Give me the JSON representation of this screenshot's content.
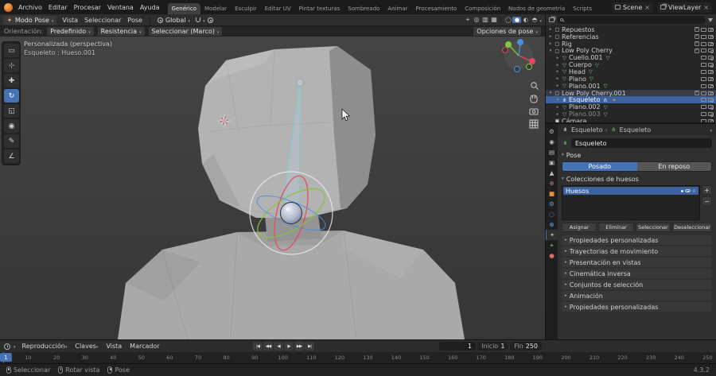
{
  "colors": {
    "accent": "#4772b3",
    "selection": "#3c62a0",
    "axis_x": "#e5485a",
    "axis_y": "#84c43c",
    "axis_z": "#4a8fe0",
    "bone_selected_outline": "#7bcfd2"
  },
  "topbar": {
    "menus": [
      "Archivo",
      "Editar",
      "Procesar",
      "Ventana",
      "Ayuda"
    ],
    "workspaces": [
      "Genérico",
      "Modelar",
      "Esculpir",
      "Editar UV",
      "Pintar texturas",
      "Sombreado",
      "Animar",
      "Procesamiento",
      "Composición",
      "Nodos de geometría",
      "Scripts"
    ],
    "active_workspace": "Genérico",
    "scene_label": "Scene",
    "view_layer_label": "ViewLayer"
  },
  "viewport_header": {
    "mode_label": "Modo Pose",
    "mode_icon": "pose-mode-icon",
    "mode_glyph": "✦",
    "menus": [
      "Vista",
      "Seleccionar",
      "Pose"
    ],
    "orientation": "Global",
    "overlay_toggles": [
      {
        "name": "selectability",
        "glyph": "⌖"
      },
      {
        "name": "gizmos",
        "glyph": "◎"
      },
      {
        "name": "overlays",
        "glyph": "▥"
      },
      {
        "name": "xray",
        "glyph": "▦"
      }
    ],
    "shading_modes": [
      {
        "name": "wireframe",
        "glyph": "◯"
      },
      {
        "name": "solid",
        "glyph": "●",
        "active": true
      },
      {
        "name": "material",
        "glyph": "◐"
      },
      {
        "name": "rendered",
        "glyph": "◓"
      }
    ]
  },
  "tool_settings": {
    "orientation_label": "Orientación:",
    "orientation_value": "Predefinido",
    "falloff_label": "Resistencia",
    "select_box_label": "Seleccionar (Marco)",
    "pose_options_label": "Opciones de pose"
  },
  "toolbar": {
    "tools": [
      {
        "name": "select-box",
        "glyph": "▭"
      },
      {
        "name": "cursor",
        "glyph": "⊹"
      },
      {
        "name": "move",
        "glyph": "✚"
      },
      {
        "name": "rotate",
        "glyph": "↻",
        "active": true
      },
      {
        "name": "scale",
        "glyph": "◱"
      },
      {
        "name": "transform",
        "glyph": "◉"
      },
      {
        "name": "annotate",
        "glyph": "✎"
      },
      {
        "name": "measure",
        "glyph": "∠"
      }
    ]
  },
  "viewport": {
    "view_label": "Personalizada (perspectiva)",
    "active_label": "Esqueleto : Hueso.001"
  },
  "outliner": {
    "type_icons": {
      "collection": "▢",
      "mesh": "▽",
      "armature": "⋔",
      "camera": "▣"
    },
    "rows": [
      {
        "label": "Repuestos",
        "depth": 0,
        "type": "collection",
        "arrow": "closed"
      },
      {
        "label": "Referencias",
        "depth": 0,
        "type": "collection",
        "arrow": "closed"
      },
      {
        "label": "Rig",
        "depth": 0,
        "type": "collection",
        "arrow": "closed"
      },
      {
        "label": "Low Poly Cherry",
        "depth": 0,
        "type": "collection",
        "arrow": "open"
      },
      {
        "label": "Cuello.001",
        "depth": 1,
        "type": "mesh",
        "arrow": "closed"
      },
      {
        "label": "Cuerpo",
        "depth": 1,
        "type": "mesh",
        "arrow": "closed"
      },
      {
        "label": "Head",
        "depth": 1,
        "type": "mesh",
        "arrow": "closed"
      },
      {
        "label": "Plano",
        "depth": 1,
        "type": "mesh",
        "arrow": "closed"
      },
      {
        "label": "Plano.001",
        "depth": 1,
        "type": "mesh",
        "arrow": "closed"
      },
      {
        "label": "Low Poly Cherry.001",
        "depth": 0,
        "type": "collection",
        "arrow": "open",
        "active": true
      },
      {
        "label": "Esqueleto",
        "depth": 1,
        "type": "armature",
        "arrow": "open",
        "selected": true
      },
      {
        "label": "Plano.002",
        "depth": 1,
        "type": "mesh",
        "arrow": "closed"
      },
      {
        "label": "Plano.003",
        "depth": 1,
        "type": "mesh",
        "arrow": "closed",
        "dim": true
      },
      {
        "label": "Cámara",
        "depth": 0,
        "type": "camera",
        "arrow": "none"
      }
    ]
  },
  "properties": {
    "tabs": [
      {
        "name": "tool",
        "glyph": "⚙",
        "color": "#bdbdbd"
      },
      {
        "name": "render",
        "glyph": "◉",
        "color": "#bdbdbd"
      },
      {
        "name": "output",
        "glyph": "▤",
        "color": "#bdbdbd"
      },
      {
        "name": "view-layer",
        "glyph": "▣",
        "color": "#bdbdbd"
      },
      {
        "name": "scene",
        "glyph": "▲",
        "color": "#bdbdbd"
      },
      {
        "name": "world",
        "glyph": "⊕",
        "color": "#c77d7d"
      },
      {
        "name": "object",
        "glyph": "■",
        "color": "#e8913c"
      },
      {
        "name": "modifiers",
        "glyph": "⚙",
        "color": "#6fa8dc"
      },
      {
        "name": "physics",
        "glyph": "◌",
        "color": "#6fa8dc"
      },
      {
        "name": "constraints",
        "glyph": "⊗",
        "color": "#6fa8dc"
      },
      {
        "name": "object-data",
        "glyph": "✦",
        "color": "#7ed37e",
        "active": true
      },
      {
        "name": "bone",
        "glyph": "⌖",
        "color": "#7ed37e"
      },
      {
        "name": "material",
        "glyph": "●",
        "color": "#d96d6d"
      }
    ],
    "breadcrumb": {
      "object": "Esqueleto",
      "data": "Esqueleto"
    },
    "name_field": "Esqueleto",
    "pose_panel": {
      "title": "Pose",
      "options": [
        "Posado",
        "En reposo"
      ],
      "active_option": "Posado"
    },
    "bone_collections_panel": {
      "title": "Colecciones de huesos",
      "items": [
        {
          "name": "Huesos",
          "selected": true
        }
      ],
      "buttons": [
        "Asignar",
        "Eliminar",
        "Seleccionar",
        "Deseleccionar"
      ]
    },
    "collapsed_panels": [
      "Propiedades personalizadas",
      "Trayectorias de movimiento",
      "Presentación en vistas",
      "Cinemática inversa",
      "Conjuntos de selección",
      "Animación",
      "Propiedades personalizadas"
    ]
  },
  "timeline": {
    "menus": [
      "Reproducción",
      "Claves",
      "Vista",
      "Marcador"
    ],
    "transport": [
      {
        "name": "jump-to-start",
        "glyph": "|◀"
      },
      {
        "name": "prev-keyframe",
        "glyph": "◀◀"
      },
      {
        "name": "play-reverse",
        "glyph": "◀"
      },
      {
        "name": "play",
        "glyph": "▶"
      },
      {
        "name": "next-keyframe",
        "glyph": "▶▶"
      },
      {
        "name": "jump-to-end",
        "glyph": "▶|"
      }
    ],
    "current_frame": "1",
    "start_label": "Inicio",
    "start_value": "1",
    "end_label": "Fin",
    "end_value": "250",
    "ruler": {
      "min": 0,
      "max": 250,
      "label_step": 10
    },
    "playhead_frame": 1
  },
  "statusbar": {
    "hints": [
      {
        "icon": "mouse-left",
        "label": "Seleccionar"
      },
      {
        "icon": "mouse-middle",
        "label": "Rotar vista"
      },
      {
        "icon": "mouse-right",
        "label": "Pose"
      }
    ],
    "version": "4.3.2"
  }
}
